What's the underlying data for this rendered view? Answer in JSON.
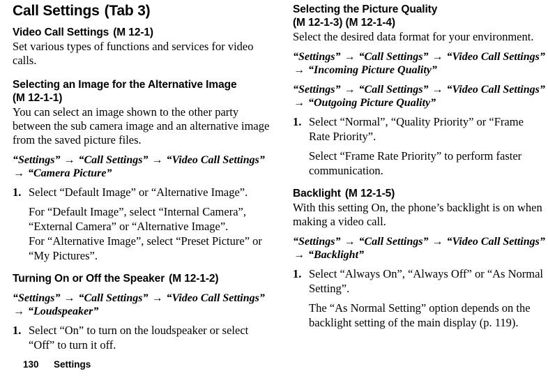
{
  "page": {
    "title_main": "Call Settings",
    "title_tab": "(Tab 3)",
    "footer_page_number": "130",
    "footer_section": "Settings",
    "arrow_glyph": "→"
  },
  "left_column": {
    "section_video_call": {
      "heading": "Video Call Settings",
      "heading_code": "(M 12-1)",
      "intro": "Set various types of functions and services for video calls."
    },
    "section_alternative_image": {
      "heading": "Selecting an Image for the Alternative Image",
      "heading_code": "(M 12-1-1)",
      "intro": "You can select an image shown to the other party between the sub camera image and an alternative image from the saved picture files.",
      "path_parts": [
        "“Settings”",
        "“Call Settings”",
        "“Video Call Settings”",
        "“Camera Picture”"
      ],
      "step_number": "1.",
      "step_text": "Select “Default Image” or “Alternative Image”.",
      "step_sub_1": "For “Default Image”, select “Internal Camera”, “External Camera” or “Alternative Image”.",
      "step_sub_2": "For “Alternative Image”, select “Preset Picture” or “My Pictures”."
    },
    "section_speaker": {
      "heading": "Turning On or Off the Speaker",
      "heading_code": "(M 12-1-2)",
      "path_parts": [
        "“Settings”",
        "“Call Settings”",
        "“Video Call Settings”",
        "“Loudspeaker”"
      ],
      "step_number": "1.",
      "step_text": "Select “On” to turn on the loudspeaker or select “Off” to turn it off."
    }
  },
  "right_column": {
    "section_picture_quality": {
      "heading": "Selecting the Picture Quality",
      "heading_code": "(M 12-1-3) (M 12-1-4)",
      "intro": "Select the desired data format for your environment.",
      "path_parts_1": [
        "“Settings”",
        "“Call Settings”",
        "“Video Call Settings”",
        "“Incoming Picture Quality”"
      ],
      "path_parts_2": [
        "“Settings”",
        "“Call Settings”",
        "“Video Call Settings”",
        "“Outgoing Picture Quality”"
      ],
      "step_number": "1.",
      "step_text": "Select “Normal”, “Quality Priority” or “Frame Rate Priority”.",
      "step_sub_1": "Select “Frame Rate Priority” to perform faster communication."
    },
    "section_backlight": {
      "heading": "Backlight",
      "heading_code": "(M 12-1-5)",
      "intro": "With this setting On, the phone’s backlight is on when making a video call.",
      "path_parts": [
        "“Settings”",
        "“Call Settings”",
        "“Video Call Settings”",
        "“Backlight”"
      ],
      "step_number": "1.",
      "step_text": "Select “Always On”, “Always Off” or “As Normal Setting”.",
      "step_sub_1": "The “As Normal Setting” option depends on the backlight setting of the main display (p. 119)."
    }
  }
}
